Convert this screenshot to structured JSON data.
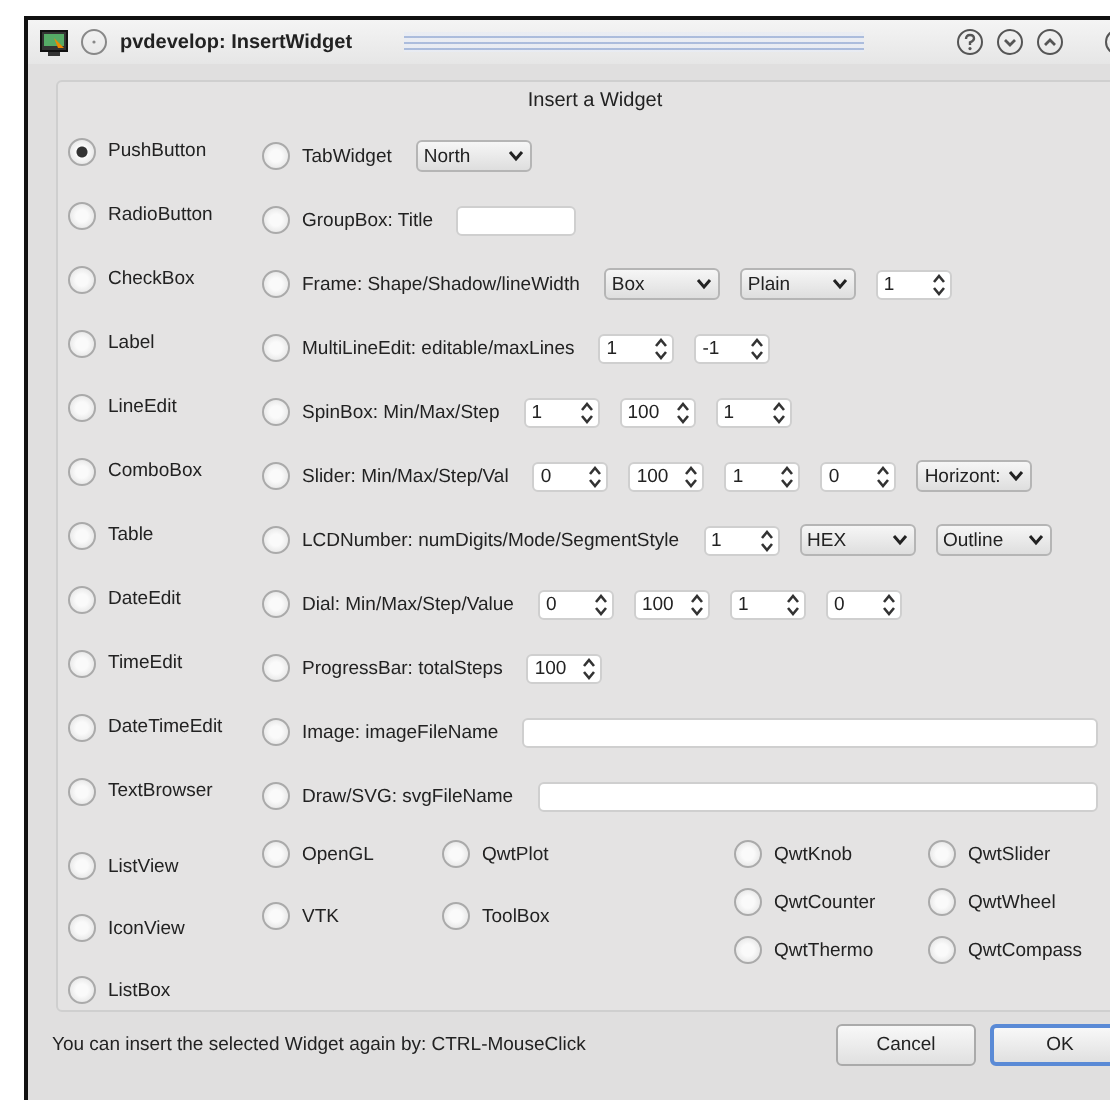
{
  "window": {
    "title": "pvdevelop: InsertWidget"
  },
  "group": {
    "title": "Insert a Widget"
  },
  "rows": [
    {
      "left": {
        "label": "PushButton",
        "selected": true
      },
      "right": {
        "label": "TabWidget",
        "selected": false
      },
      "controls": [
        {
          "kind": "combo",
          "value": "North"
        }
      ]
    },
    {
      "left": {
        "label": "RadioButton",
        "selected": false
      },
      "right": {
        "label": "GroupBox: Title",
        "selected": false
      },
      "controls": [
        {
          "kind": "text"
        }
      ]
    },
    {
      "left": {
        "label": "CheckBox",
        "selected": false
      },
      "right": {
        "label": "Frame: Shape/Shadow/lineWidth",
        "selected": false
      },
      "controls": [
        {
          "kind": "combo",
          "value": "Box"
        },
        {
          "kind": "combo",
          "value": "Plain"
        },
        {
          "kind": "spin",
          "value": "1"
        }
      ]
    },
    {
      "left": {
        "label": "Label",
        "selected": false
      },
      "right": {
        "label": "MultiLineEdit: editable/maxLines",
        "selected": false
      },
      "controls": [
        {
          "kind": "spin",
          "value": "1"
        },
        {
          "kind": "spin",
          "value": "-1"
        }
      ]
    },
    {
      "left": {
        "label": "LineEdit",
        "selected": false
      },
      "right": {
        "label": "SpinBox: Min/Max/Step",
        "selected": false
      },
      "controls": [
        {
          "kind": "spin",
          "value": "1"
        },
        {
          "kind": "spin",
          "value": "100"
        },
        {
          "kind": "spin",
          "value": "1"
        }
      ]
    },
    {
      "left": {
        "label": "ComboBox",
        "selected": false
      },
      "right": {
        "label": "Slider: Min/Max/Step/Val",
        "selected": false
      },
      "controls": [
        {
          "kind": "spin",
          "value": "0"
        },
        {
          "kind": "spin",
          "value": "100"
        },
        {
          "kind": "spin",
          "value": "1"
        },
        {
          "kind": "spin",
          "value": "0"
        },
        {
          "kind": "combo",
          "value": "Horizont:"
        }
      ]
    },
    {
      "left": {
        "label": "Table",
        "selected": false
      },
      "right": {
        "label": "LCDNumber: numDigits/Mode/SegmentStyle",
        "selected": false
      },
      "controls": [
        {
          "kind": "spin",
          "value": "1"
        },
        {
          "kind": "combo",
          "value": "HEX"
        },
        {
          "kind": "combo",
          "value": "Outline"
        }
      ]
    },
    {
      "left": {
        "label": "DateEdit",
        "selected": false
      },
      "right": {
        "label": "Dial: Min/Max/Step/Value",
        "selected": false
      },
      "controls": [
        {
          "kind": "spin",
          "value": "0"
        },
        {
          "kind": "spin",
          "value": "100"
        },
        {
          "kind": "spin",
          "value": "1"
        },
        {
          "kind": "spin",
          "value": "0"
        }
      ]
    },
    {
      "left": {
        "label": "TimeEdit",
        "selected": false
      },
      "right": {
        "label": "ProgressBar: totalSteps",
        "selected": false
      },
      "controls": [
        {
          "kind": "spin",
          "value": "100"
        }
      ]
    },
    {
      "left": {
        "label": "DateTimeEdit",
        "selected": false
      },
      "right": {
        "label": "Image: imageFileName",
        "selected": false
      },
      "controls": [
        {
          "kind": "path"
        }
      ]
    },
    {
      "left": {
        "label": "TextBrowser",
        "selected": false
      },
      "right": {
        "label": "Draw/SVG: svgFileName",
        "selected": false
      },
      "controls": [
        {
          "kind": "path"
        }
      ]
    }
  ],
  "extra_columns": [
    [
      {
        "label": "ListView",
        "selected": false
      },
      {
        "label": "IconView",
        "selected": false
      },
      {
        "label": "ListBox",
        "selected": false
      }
    ],
    [
      {
        "label": "OpenGL",
        "selected": false
      },
      {
        "label": "VTK",
        "selected": false
      }
    ],
    [
      {
        "label": "QwtPlot",
        "selected": false
      },
      {
        "label": "ToolBox",
        "selected": false
      }
    ],
    [
      {
        "label": "QwtKnob",
        "selected": false
      },
      {
        "label": "QwtCounter",
        "selected": false
      },
      {
        "label": "QwtThermo",
        "selected": false
      }
    ],
    [
      {
        "label": "QwtSlider",
        "selected": false
      },
      {
        "label": "QwtWheel",
        "selected": false
      },
      {
        "label": "QwtCompass",
        "selected": false
      }
    ]
  ],
  "hint": "You can insert the selected Widget again by: CTRL-MouseClick",
  "buttons": [
    {
      "label": "Cancel",
      "default": false
    },
    {
      "label": "OK",
      "default": true
    }
  ]
}
